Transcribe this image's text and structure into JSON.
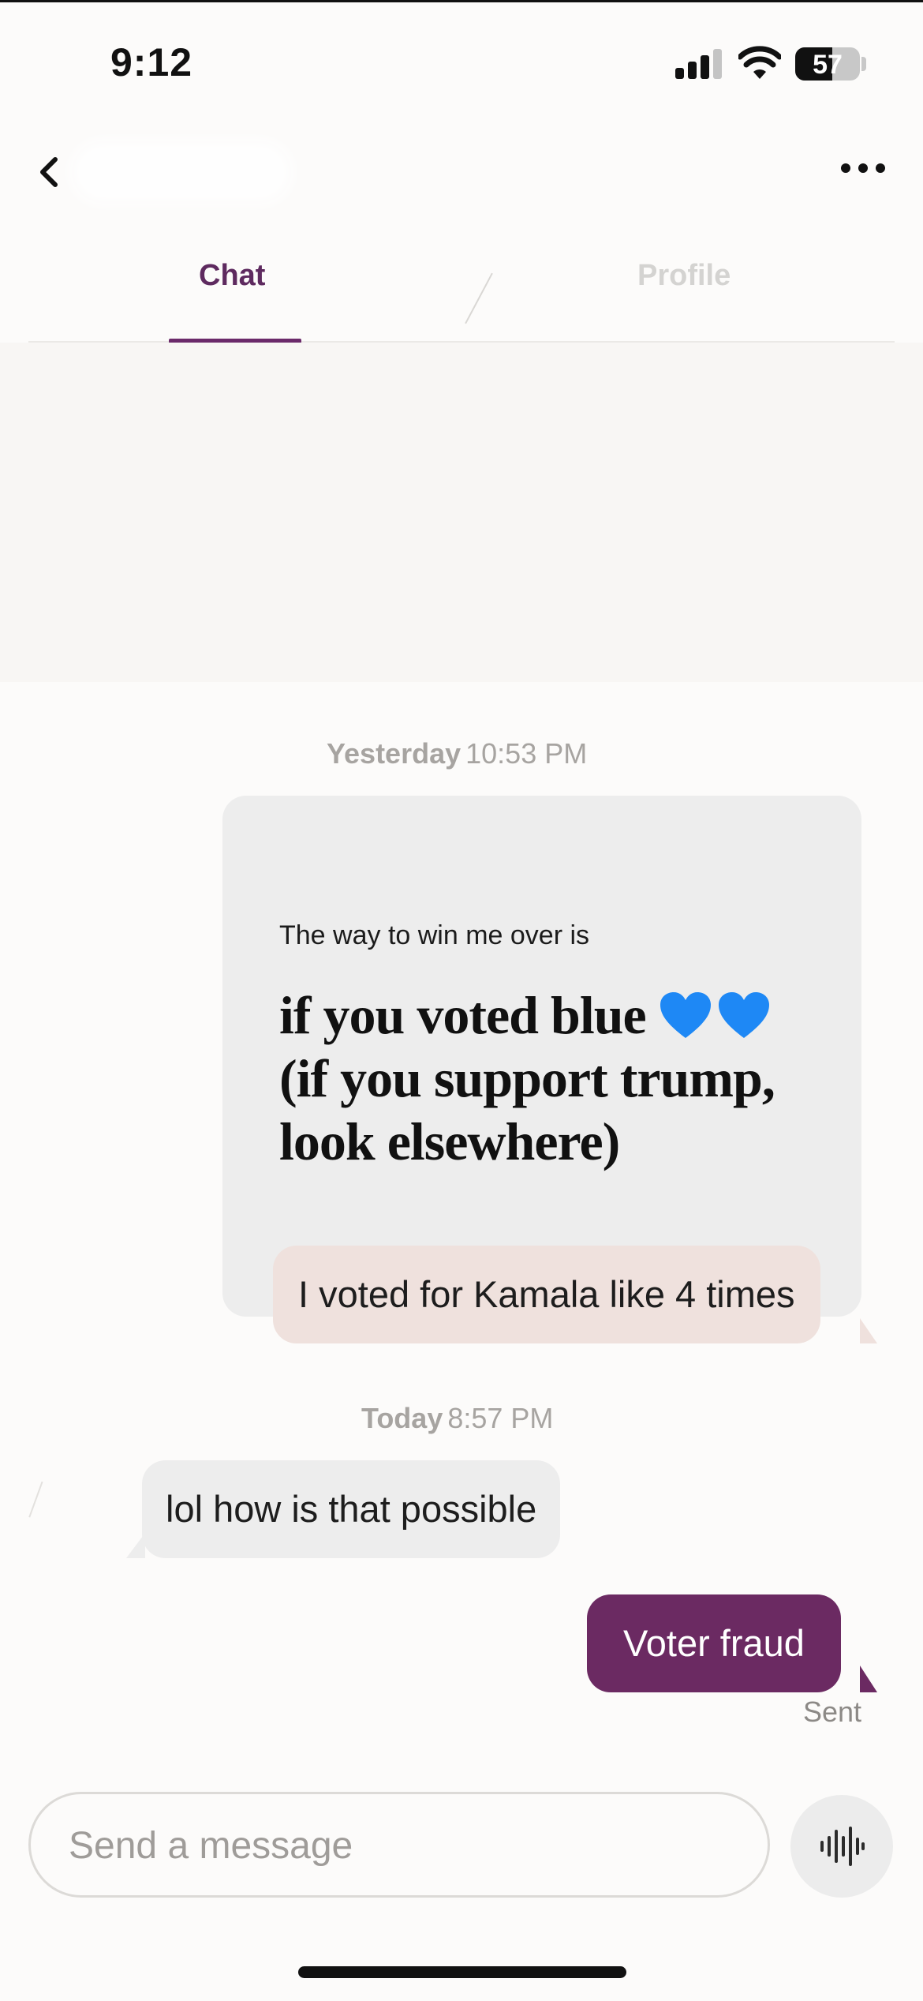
{
  "status_bar": {
    "time": "9:12",
    "battery": "57",
    "battery_level": 0.57
  },
  "tabs": [
    {
      "label": "Chat",
      "active": true
    },
    {
      "label": "Profile",
      "active": false
    }
  ],
  "messages": {
    "day1": {
      "day": "Yesterday",
      "time": "10:53 PM"
    },
    "prompt": {
      "question": "The way to win me over is",
      "answer": "if you voted blue 💙💙 (if you support trump, look elsewhere)"
    },
    "reply": "I voted for Kamala like 4 times",
    "day2": {
      "day": "Today",
      "time": "8:57 PM"
    },
    "received": "lol how is that possible",
    "sent": "Voter fraud",
    "sent_status": "Sent"
  },
  "composer": {
    "placeholder": "Send a message"
  },
  "colors": {
    "accent": "#6b2a62",
    "tab_active": "#5e2a5f",
    "reply_bubble": "#efe1dd",
    "received_bubble": "#ededed",
    "prompt_card": "#ededed",
    "heart": "#1e88f5"
  },
  "icons": [
    "back-chevron-icon",
    "more-icon",
    "voice-note-icon",
    "heart-icon"
  ]
}
